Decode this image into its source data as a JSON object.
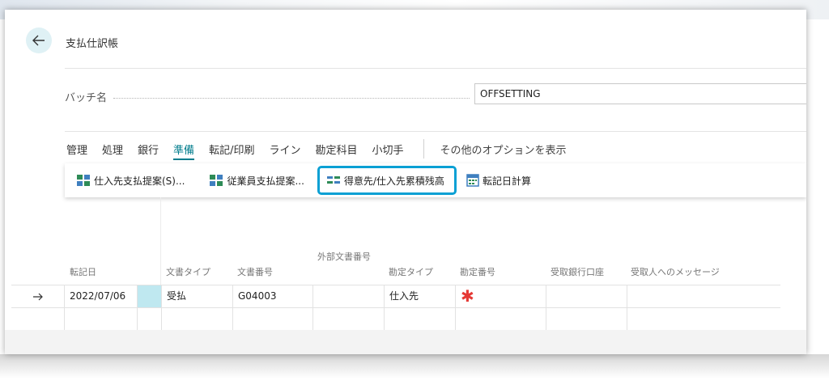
{
  "page": {
    "title": "支払仕訳帳"
  },
  "batch": {
    "label": "バッチ名",
    "value": "OFFSETTING"
  },
  "menu": {
    "items": [
      "管理",
      "処理",
      "銀行",
      "準備",
      "転記/印刷",
      "ライン",
      "勘定科目",
      "小切手"
    ],
    "active": "準備",
    "more": "その他のオプションを表示"
  },
  "actions": [
    {
      "label": "仕入先支払提案(S)...",
      "icon": "suggest-payments-icon"
    },
    {
      "label": "従業員支払提案...",
      "icon": "suggest-employee-payments-icon"
    },
    {
      "label": "得意先/仕入先累積残高",
      "icon": "balance-icon",
      "highlighted": true
    },
    {
      "label": "転記日計算",
      "icon": "calendar-calculator-icon"
    }
  ],
  "table": {
    "columns": [
      "転記日",
      "文書タイプ",
      "文書番号",
      "外部文書番号",
      "勘定タイプ",
      "勘定番号",
      "受取銀行口座",
      "受取人へのメッセージ"
    ],
    "rows": [
      {
        "posting_date": "2022/07/06",
        "document_type": "受払",
        "document_no": "G04003",
        "external_doc_no": "",
        "account_type": "仕入先",
        "account_no": "",
        "recipient_bank": "",
        "message": ""
      },
      {
        "posting_date": "",
        "document_type": "",
        "document_no": "",
        "external_doc_no": "",
        "account_type": "",
        "account_no": "",
        "recipient_bank": "",
        "message": ""
      }
    ]
  },
  "colors": {
    "accent": "#007c8c",
    "highlight_border": "#0aa0d4",
    "required": "#e53935",
    "selected_cell": "#bfe8f0"
  }
}
